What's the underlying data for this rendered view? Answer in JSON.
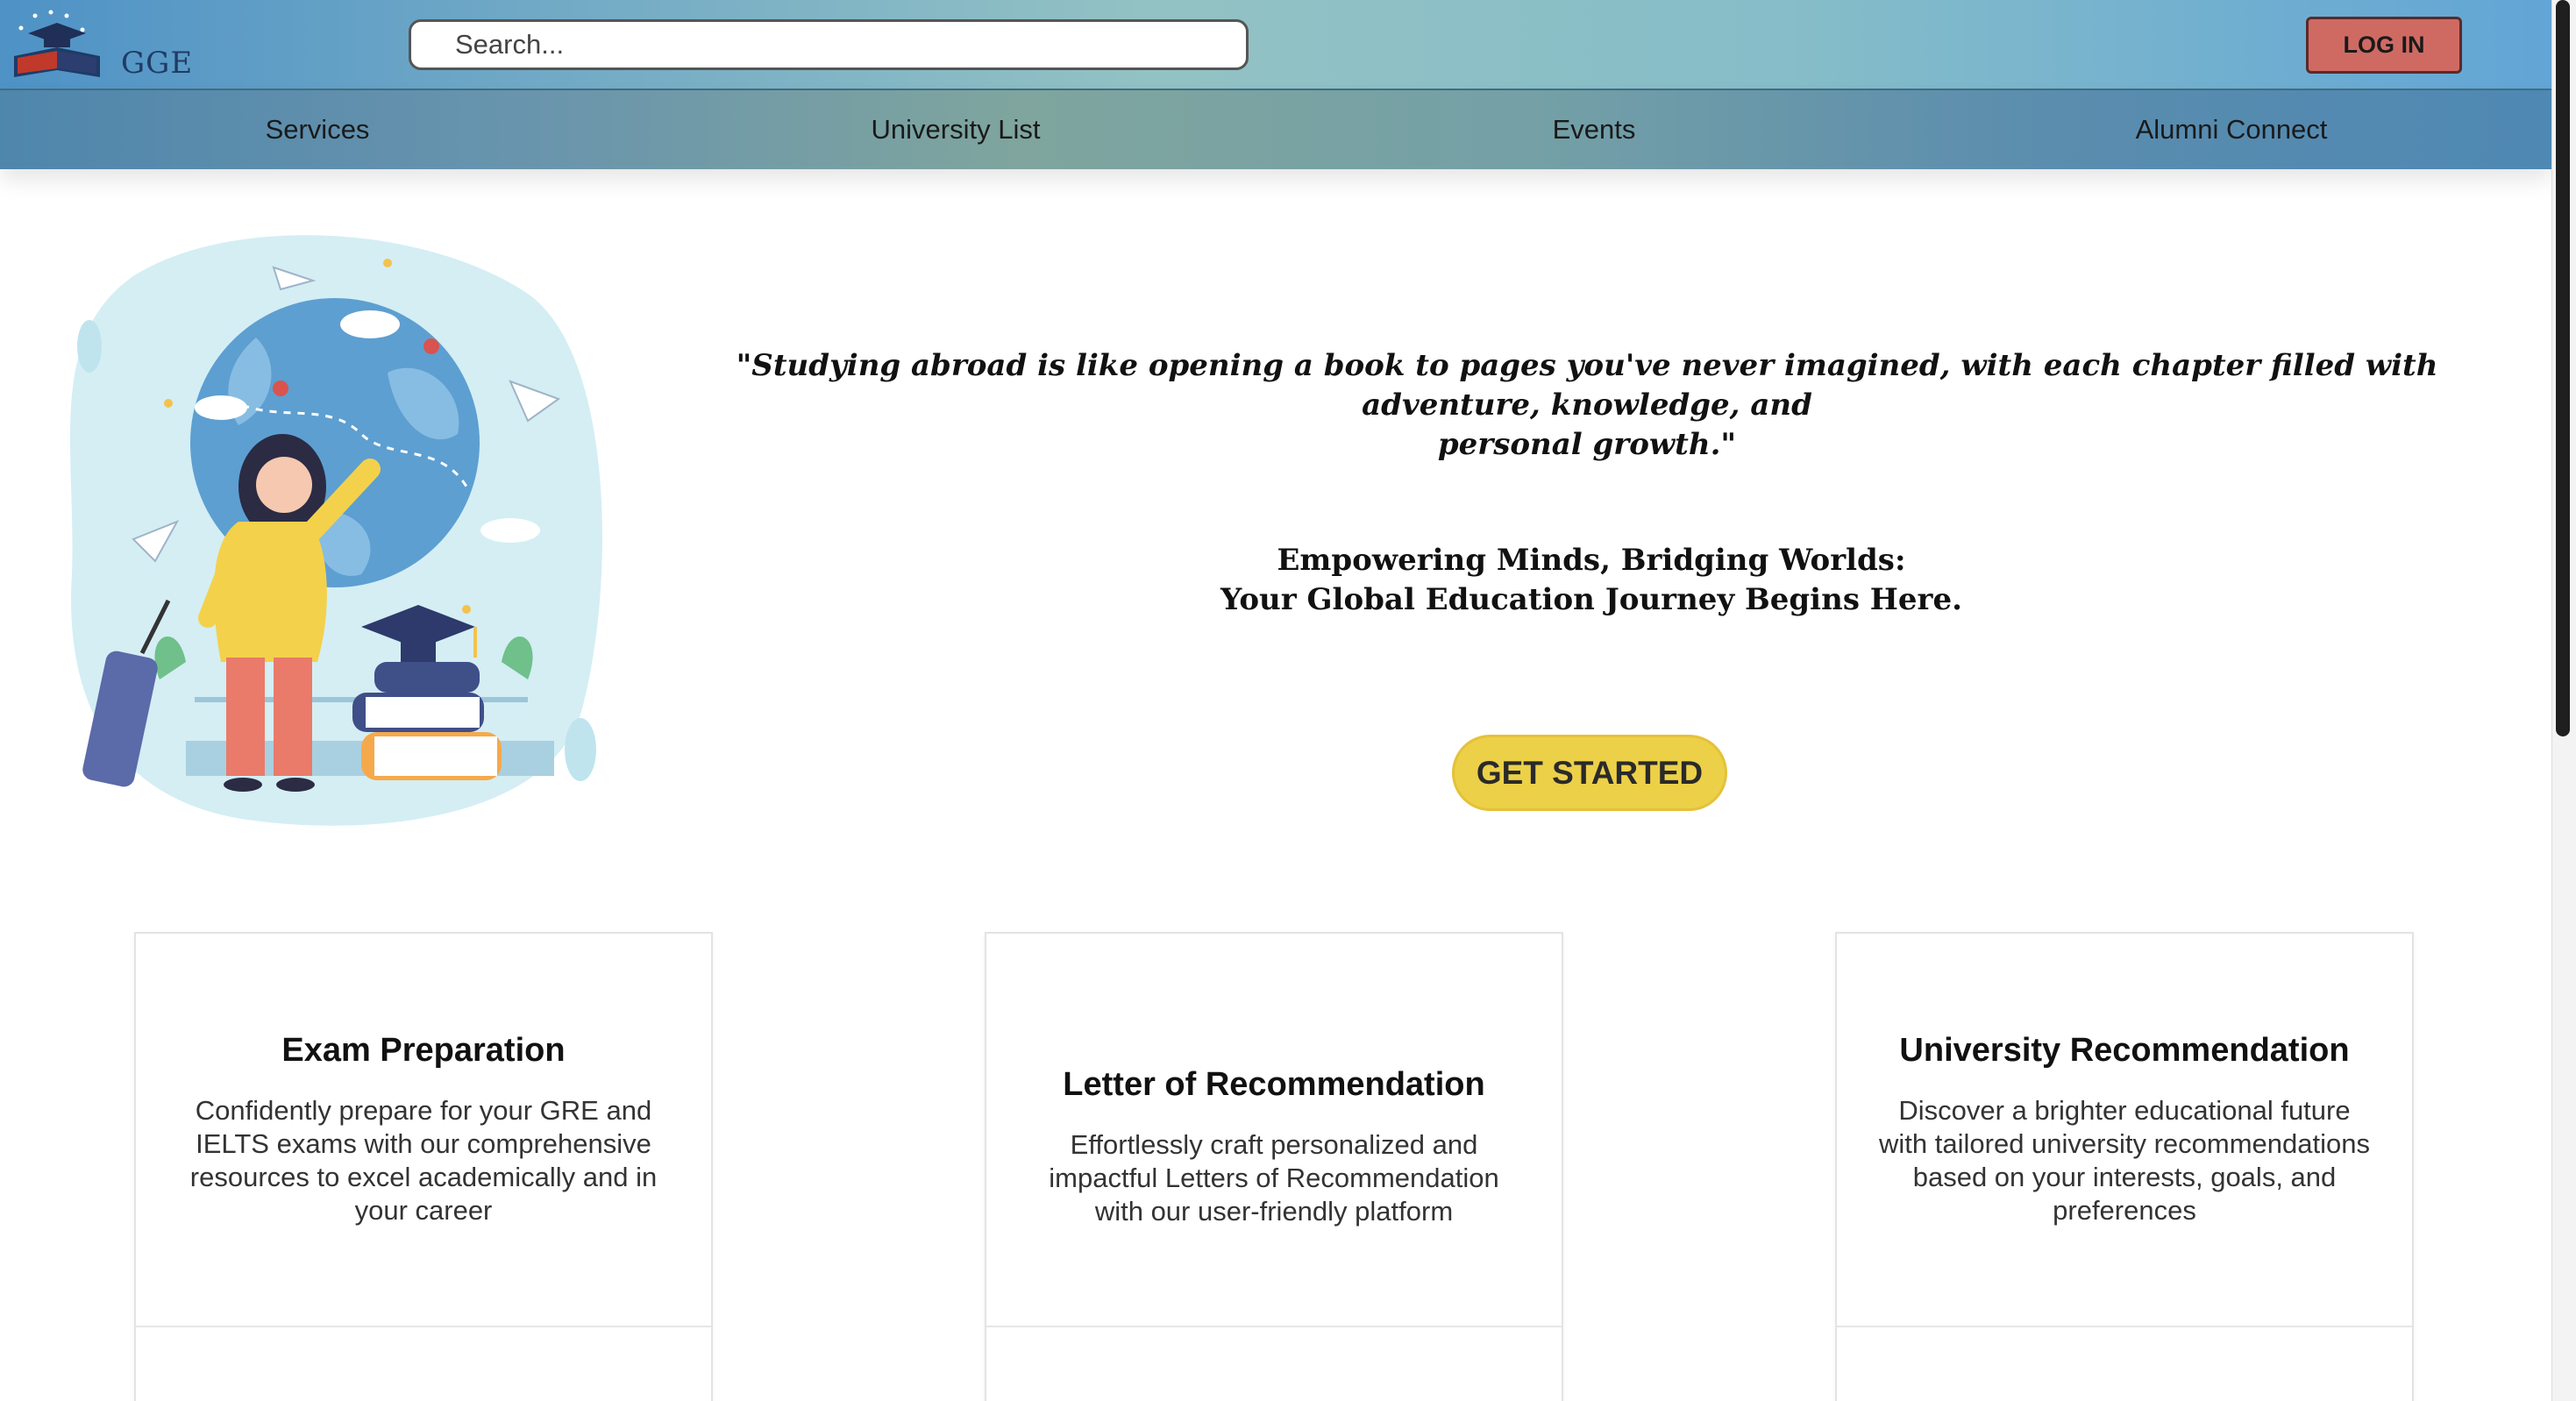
{
  "header": {
    "brand": "GGE",
    "search_placeholder": "Search...",
    "login_label": "LOG IN"
  },
  "nav": {
    "items": [
      {
        "label": "Services"
      },
      {
        "label": "University List"
      },
      {
        "label": "Events"
      },
      {
        "label": "Alumni Connect"
      }
    ]
  },
  "hero": {
    "quote_line1": "\"Studying abroad is like opening a book to pages you've never imagined, with each chapter filled with adventure, knowledge, and",
    "quote_line2": "personal growth.\"",
    "tagline_line1": "Empowering Minds, Bridging Worlds:",
    "tagline_line2": "Your Global Education Journey Begins Here.",
    "cta_label": "GET STARTED"
  },
  "cards": [
    {
      "title": "Exam Preparation",
      "text": "Confidently prepare for your GRE and IELTS exams with our comprehensive resources to excel academically and in your career"
    },
    {
      "title": "Letter of Recommendation",
      "text": "Effortlessly craft personalized and impactful Letters of Recommendation with our user-friendly platform"
    },
    {
      "title": "University Recommendation",
      "text": "Discover a brighter educational future with tailored university recommendations based on your interests, goals, and preferences"
    }
  ],
  "colors": {
    "login_button": "#cf6a63",
    "cta_button": "#ecd048",
    "header_gradient_start": "#4e92c6",
    "header_gradient_mid": "#93c2c4"
  }
}
